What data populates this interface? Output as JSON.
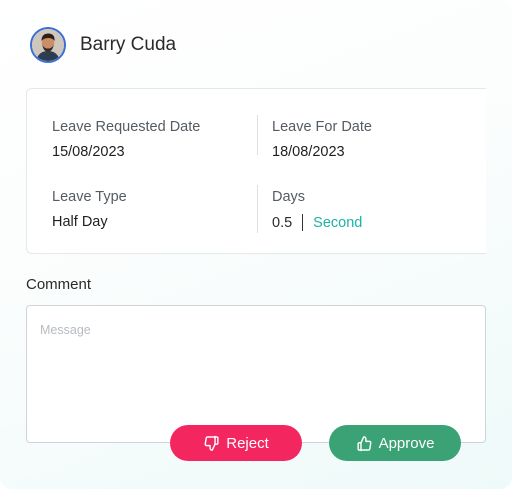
{
  "employee": {
    "name": "Barry Cuda",
    "avatar_icon": "user-avatar-photo"
  },
  "leave": {
    "requested_date_label": "Leave Requested Date",
    "requested_date": "15/08/2023",
    "for_date_label": "Leave For Date",
    "for_date": "18/08/2023",
    "type_label": "Leave Type",
    "type": "Half Day",
    "days_label": "Days",
    "days": "0.5",
    "half": "Second"
  },
  "comment": {
    "label": "Comment",
    "placeholder": "Message",
    "value": ""
  },
  "actions": {
    "reject_label": "Reject",
    "reject_icon": "thumbs-down-icon",
    "approve_label": "Approve",
    "approve_icon": "thumbs-up-icon"
  },
  "colors": {
    "reject": "#f32660",
    "approve": "#3aa274",
    "accent": "#1bb3a5"
  }
}
